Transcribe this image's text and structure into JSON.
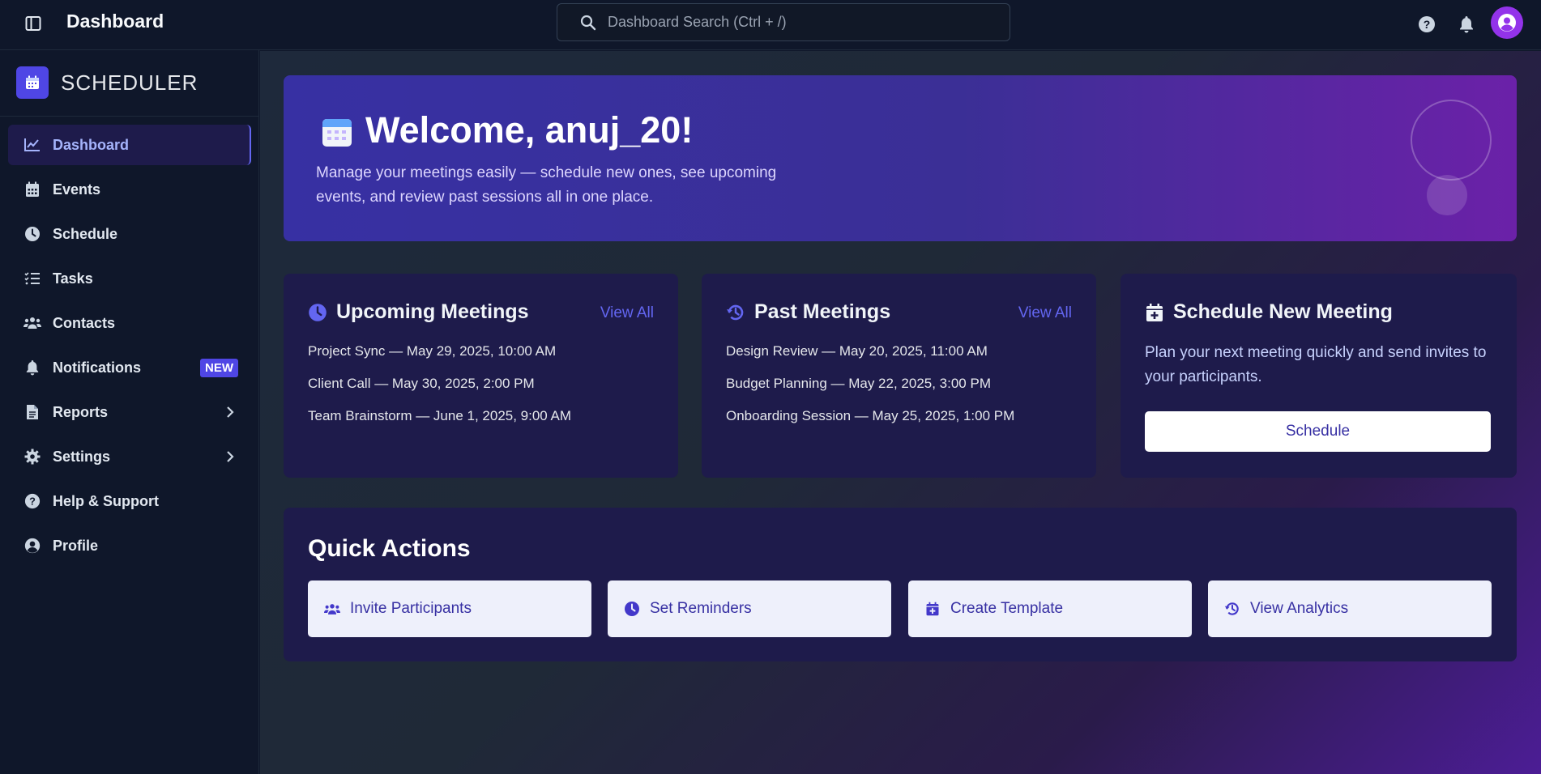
{
  "topbar": {
    "title": "Dashboard",
    "search_placeholder": "Dashboard Search (Ctrl + /)"
  },
  "sidebar": {
    "brand": "SCHEDULER",
    "items": [
      {
        "label": "Dashboard",
        "icon": "chart-line-icon",
        "active": true
      },
      {
        "label": "Events",
        "icon": "calendar-icon"
      },
      {
        "label": "Schedule",
        "icon": "clock-icon"
      },
      {
        "label": "Tasks",
        "icon": "list-check-icon"
      },
      {
        "label": "Contacts",
        "icon": "users-icon"
      },
      {
        "label": "Notifications",
        "icon": "bell-icon",
        "badge": "NEW"
      },
      {
        "label": "Reports",
        "icon": "file-icon",
        "has_children": true
      },
      {
        "label": "Settings",
        "icon": "gear-icon",
        "has_children": true
      },
      {
        "label": "Help & Support",
        "icon": "question-circle-icon"
      },
      {
        "label": "Profile",
        "icon": "user-circle-icon"
      }
    ]
  },
  "hero": {
    "title": "Welcome, anuj_20!",
    "subtitle": "Manage your meetings easily — schedule new ones, see upcoming events, and review past sessions all in one place."
  },
  "upcoming": {
    "title": "Upcoming Meetings",
    "view_all": "View All",
    "items": [
      "Project Sync — May 29, 2025, 10:00 AM",
      "Client Call — May 30, 2025, 2:00 PM",
      "Team Brainstorm — June 1, 2025, 9:00 AM"
    ]
  },
  "past": {
    "title": "Past Meetings",
    "view_all": "View All",
    "items": [
      "Design Review — May 20, 2025, 11:00 AM",
      "Budget Planning — May 22, 2025, 3:00 PM",
      "Onboarding Session — May 25, 2025, 1:00 PM"
    ]
  },
  "schedule_new": {
    "title": "Schedule New Meeting",
    "description": "Plan your next meeting quickly and send invites to your participants.",
    "button": "Schedule"
  },
  "quick_actions": {
    "title": "Quick Actions",
    "items": [
      {
        "label": "Invite Participants",
        "icon": "users-icon"
      },
      {
        "label": "Set Reminders",
        "icon": "clock-icon"
      },
      {
        "label": "Create Template",
        "icon": "calendar-plus-icon"
      },
      {
        "label": "View Analytics",
        "icon": "history-icon"
      }
    ]
  },
  "colors": {
    "accent": "#4f46e5",
    "avatar": "#9333ea",
    "card_bg": "#1e1b4b"
  }
}
